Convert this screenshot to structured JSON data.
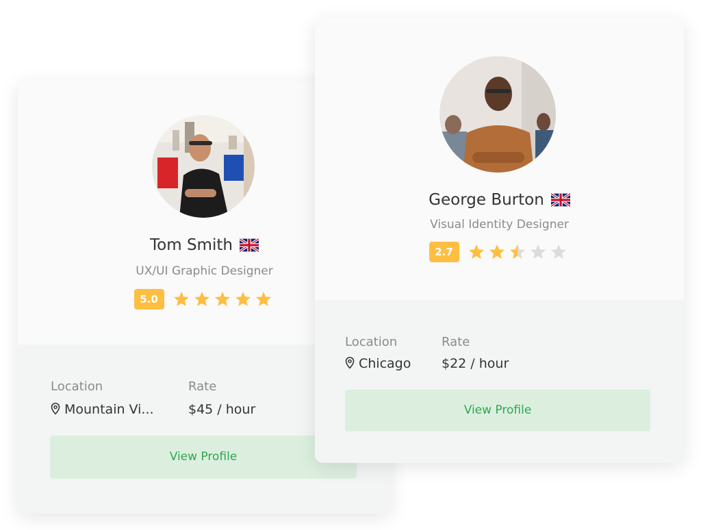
{
  "cards": [
    {
      "name": "Tom Smith",
      "country_flag": "uk-flag-icon",
      "title": "UX/UI Graphic Designer",
      "rating": "5.0",
      "stars": 5,
      "location_label": "Location",
      "location_value": "Mountain Vi...",
      "rate_label": "Rate",
      "rate_value": "$45 / hour",
      "button_label": "View Profile"
    },
    {
      "name": "George Burton",
      "country_flag": "uk-flag-icon",
      "title": "Visual Identity Designer",
      "rating": "2.7",
      "stars": 2.5,
      "location_label": "Location",
      "location_value": "Chicago",
      "rate_label": "Rate",
      "rate_value": "$22 / hour",
      "button_label": "View Profile"
    }
  ],
  "colors": {
    "star_filled": "#febe42",
    "star_empty": "#dcdcdc",
    "badge": "#febe42",
    "button_bg": "#dcefdf",
    "button_text": "#2ea650"
  }
}
